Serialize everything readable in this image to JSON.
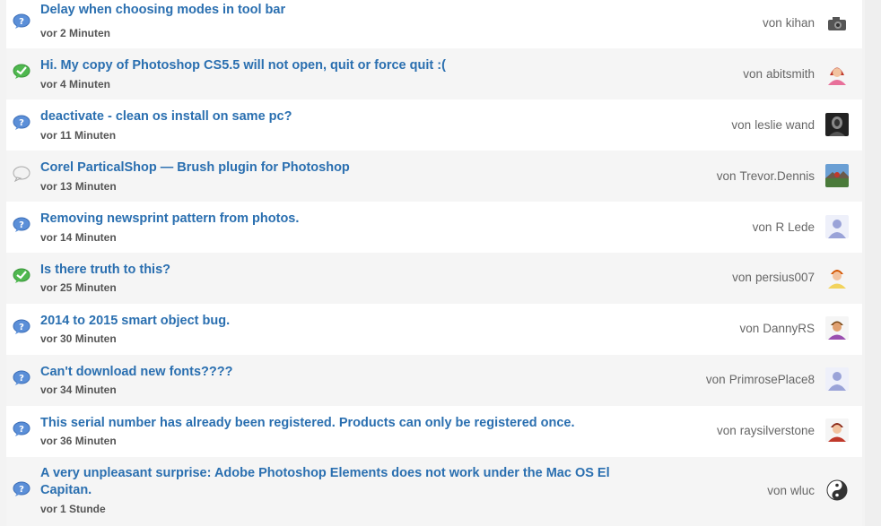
{
  "author_prefix": "von",
  "threads": [
    {
      "title": "Delay when choosing modes in tool bar",
      "time": "vor 2 Minuten",
      "author": "kihan",
      "status": "question",
      "avatar": "camera"
    },
    {
      "title": "Hi. My copy of Photoshop CS5.5 will not open, quit or force quit :(",
      "time": "vor 4 Minuten",
      "author": "abitsmith",
      "status": "answered",
      "avatar": "female"
    },
    {
      "title": "deactivate - clean os install on same pc?",
      "time": "vor 11 Minuten",
      "author": "leslie wand",
      "status": "question",
      "avatar": "dark-portrait"
    },
    {
      "title": "Corel ParticalShop — Brush plugin for Photoshop",
      "time": "vor 13 Minuten",
      "author": "Trevor.Dennis",
      "status": "discussion",
      "avatar": "landscape"
    },
    {
      "title": "Removing newsprint pattern from photos.",
      "time": "vor 14 Minuten",
      "author": "R Lede",
      "status": "question",
      "avatar": "default-user"
    },
    {
      "title": "Is there truth to this?",
      "time": "vor 25 Minuten",
      "author": "persius007",
      "status": "answered",
      "avatar": "male-orange"
    },
    {
      "title": "2014 to 2015 smart object bug.",
      "time": "vor 30 Minuten",
      "author": "DannyRS",
      "status": "question",
      "avatar": "male-dark"
    },
    {
      "title": "Can't download new fonts????",
      "time": "vor 34 Minuten",
      "author": "PrimrosePlace8",
      "status": "question",
      "avatar": "default-user"
    },
    {
      "title": "This serial number has already been registered. Products can only be registered once.",
      "time": "vor 36 Minuten",
      "author": "raysilverstone",
      "status": "question",
      "avatar": "male-red"
    },
    {
      "title": "A very unpleasant surprise: Adobe Photoshop Elements does not work under the Mac OS El Capitan.",
      "time": "vor 1 Stunde",
      "author": "wluc",
      "status": "question",
      "avatar": "yin-yang"
    }
  ],
  "colors": {
    "link": "#2a6fb0",
    "question": "#5b8fd8",
    "answered": "#4fb84f",
    "discussion": "#e4e4e4"
  }
}
